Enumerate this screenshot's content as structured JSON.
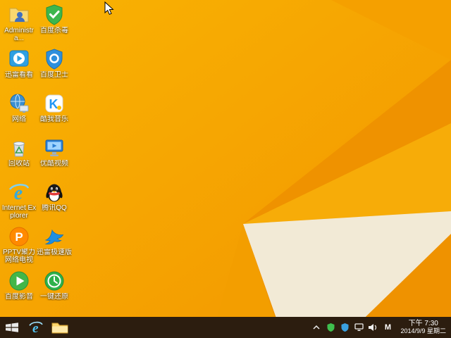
{
  "desktop": {
    "icons": [
      {
        "label": "Administra...",
        "icon": "user-folder"
      },
      {
        "label": "迅雷看看",
        "icon": "blue-player"
      },
      {
        "label": "网络",
        "icon": "network-globe"
      },
      {
        "label": "回收站",
        "icon": "recycle-bin"
      },
      {
        "label": "Internet Explorer",
        "icon": "internet-explorer"
      },
      {
        "label": "PPTV聚力网络电视",
        "icon": "pptv"
      },
      {
        "label": "百度影音",
        "icon": "green-play"
      },
      {
        "label": "百度杀毒",
        "icon": "green-shield"
      },
      {
        "label": "百度卫士",
        "icon": "blue-shield"
      },
      {
        "label": "酷我音乐",
        "icon": "kuwo-music"
      },
      {
        "label": "优酷视频",
        "icon": "blue-monitor"
      },
      {
        "label": "腾讯QQ",
        "icon": "qq-penguin"
      },
      {
        "label": "迅雷极速版",
        "icon": "thunder-bird"
      },
      {
        "label": "一键还原",
        "icon": "green-clock"
      }
    ]
  },
  "taskbar": {
    "clock": {
      "time": "下午 7:30",
      "date": "2014/9/9 星期二"
    },
    "input_indicator": "M"
  },
  "glyphs": {
    "ie_e": "e",
    "pptv_p": "P",
    "kuwo_k": "K"
  },
  "colors": {
    "wallpaper_base": "#f8b004",
    "wallpaper_deep": "#ef9200",
    "wallpaper_light": "#f7ac08",
    "wallpaper_cream": "#f2ead6",
    "taskbar": "#2c1d0f"
  }
}
